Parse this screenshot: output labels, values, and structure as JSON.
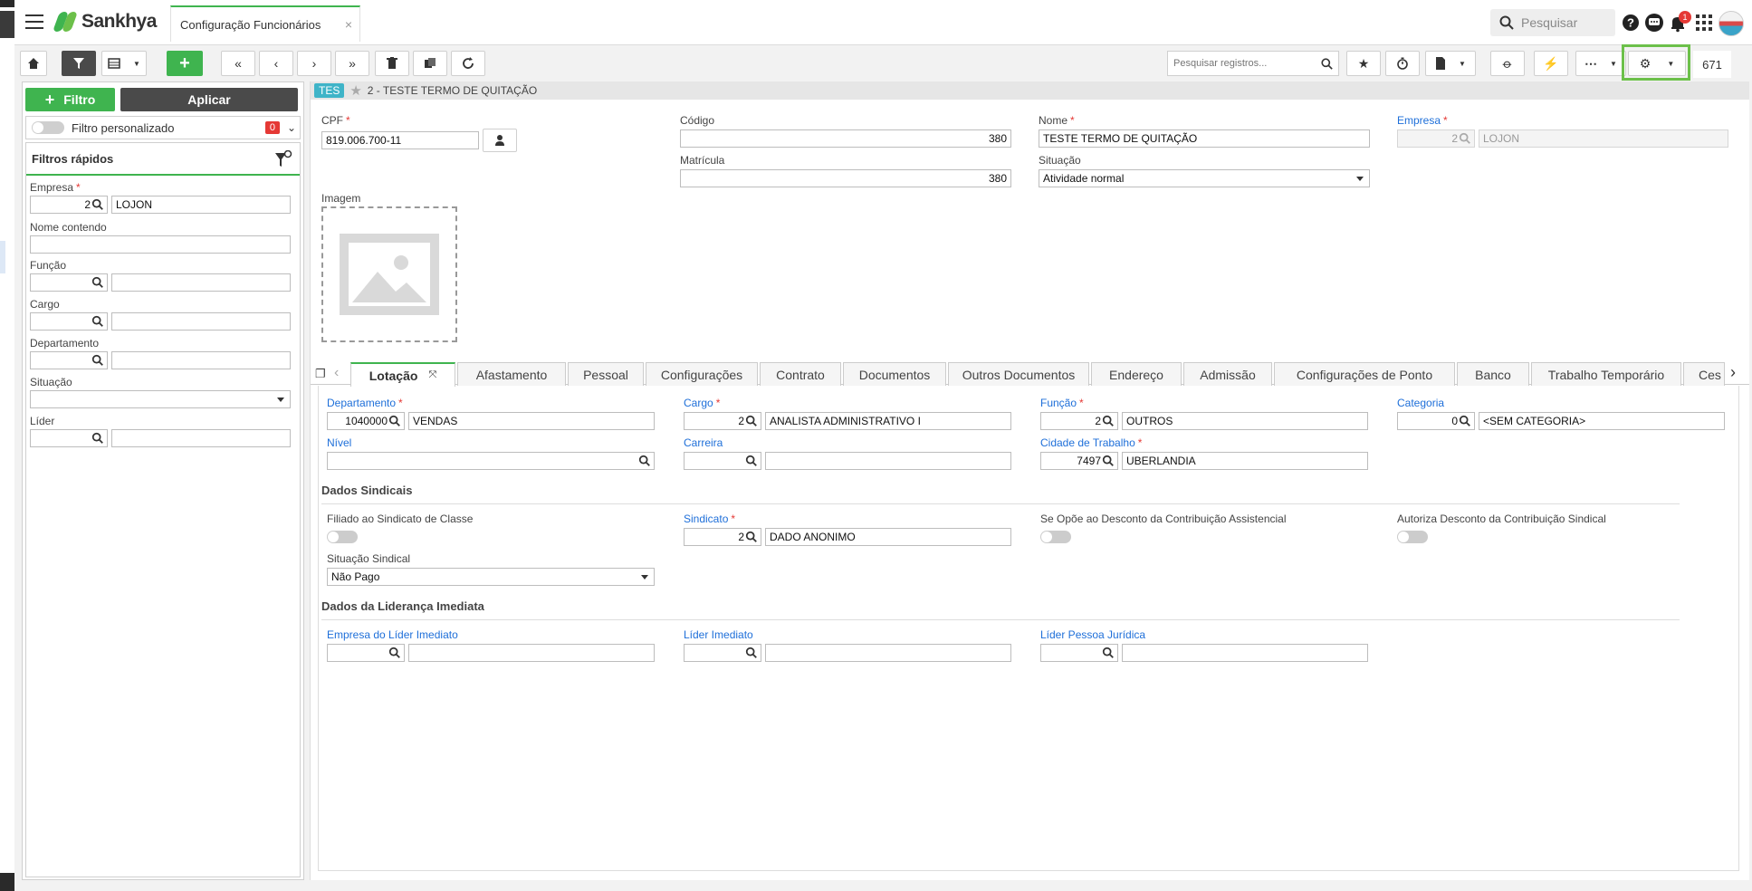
{
  "header": {
    "brand": "Sankhya",
    "tab_title": "Configuração Funcionários",
    "tab_close": "×",
    "search_placeholder": "Pesquisar",
    "notif_count": "1"
  },
  "toolbar": {
    "search_placeholder": "Pesquisar registros...",
    "record_count": "671"
  },
  "filters": {
    "filtro_label": "Filtro",
    "aplicar_label": "Aplicar",
    "custom_filter_label": "Filtro personalizado",
    "custom_filter_count": "0",
    "quick_title": "Filtros rápidos",
    "empresa_label": "Empresa",
    "empresa_code": "2",
    "empresa_name": "LOJON",
    "nome_label": "Nome contendo",
    "funcao_label": "Função",
    "cargo_label": "Cargo",
    "departamento_label": "Departamento",
    "situacao_label": "Situação",
    "lider_label": "Líder"
  },
  "record": {
    "tag": "TES",
    "title": "2 - TESTE TERMO DE QUITAÇÃO",
    "cpf_label": "CPF",
    "cpf_value": "819.006.700-11",
    "codigo_label": "Código",
    "codigo_value": "380",
    "matricula_label": "Matrícula",
    "matricula_value": "380",
    "nome_label": "Nome",
    "nome_value": "TESTE TERMO DE QUITAÇÃO",
    "situacao_label": "Situação",
    "situacao_value": "Atividade normal",
    "empresa_label": "Empresa",
    "empresa_code": "2",
    "empresa_name": "LOJON",
    "imagem_label": "Imagem"
  },
  "tabs": [
    {
      "label": "Lotação"
    },
    {
      "label": "Afastamento"
    },
    {
      "label": "Pessoal"
    },
    {
      "label": "Configurações"
    },
    {
      "label": "Contrato"
    },
    {
      "label": "Documentos"
    },
    {
      "label": "Outros Documentos"
    },
    {
      "label": "Endereço"
    },
    {
      "label": "Admissão"
    },
    {
      "label": "Configurações de Ponto"
    },
    {
      "label": "Banco"
    },
    {
      "label": "Trabalho Temporário"
    },
    {
      "label": "Ces"
    }
  ],
  "lotacao": {
    "departamento_label": "Departamento",
    "departamento_code": "1040000",
    "departamento_name": "VENDAS",
    "cargo_label": "Cargo",
    "cargo_code": "2",
    "cargo_name": "ANALISTA ADMINISTRATIVO I",
    "funcao_label": "Função",
    "funcao_code": "2",
    "funcao_name": "OUTROS",
    "categoria_label": "Categoria",
    "categoria_code": "0",
    "categoria_name": "<SEM CATEGORIA>",
    "nivel_label": "Nível",
    "carreira_label": "Carreira",
    "cidade_label": "Cidade de Trabalho",
    "cidade_code": "7497",
    "cidade_name": "UBERLANDIA",
    "sindicais_title": "Dados Sindicais",
    "filiado_label": "Filiado ao Sindicato de Classe",
    "sindicato_label": "Sindicato",
    "sindicato_code": "2",
    "sindicato_name": "DADO ANONIMO",
    "opoe_label": "Se Opõe ao Desconto da Contribuição Assistencial",
    "autoriza_label": "Autoriza Desconto da Contribuição Sindical",
    "situacao_sindical_label": "Situação Sindical",
    "situacao_sindical_value": "Não Pago",
    "lideranca_title": "Dados da Liderança Imediata",
    "empresa_lider_label": "Empresa do Líder Imediato",
    "lider_imediato_label": "Líder Imediato",
    "lider_pj_label": "Líder Pessoa Jurídica"
  },
  "colors": {
    "accent": "#3fb44f",
    "dark": "#4a4a4a",
    "link": "#1e6fd9",
    "required": "#e53935"
  }
}
